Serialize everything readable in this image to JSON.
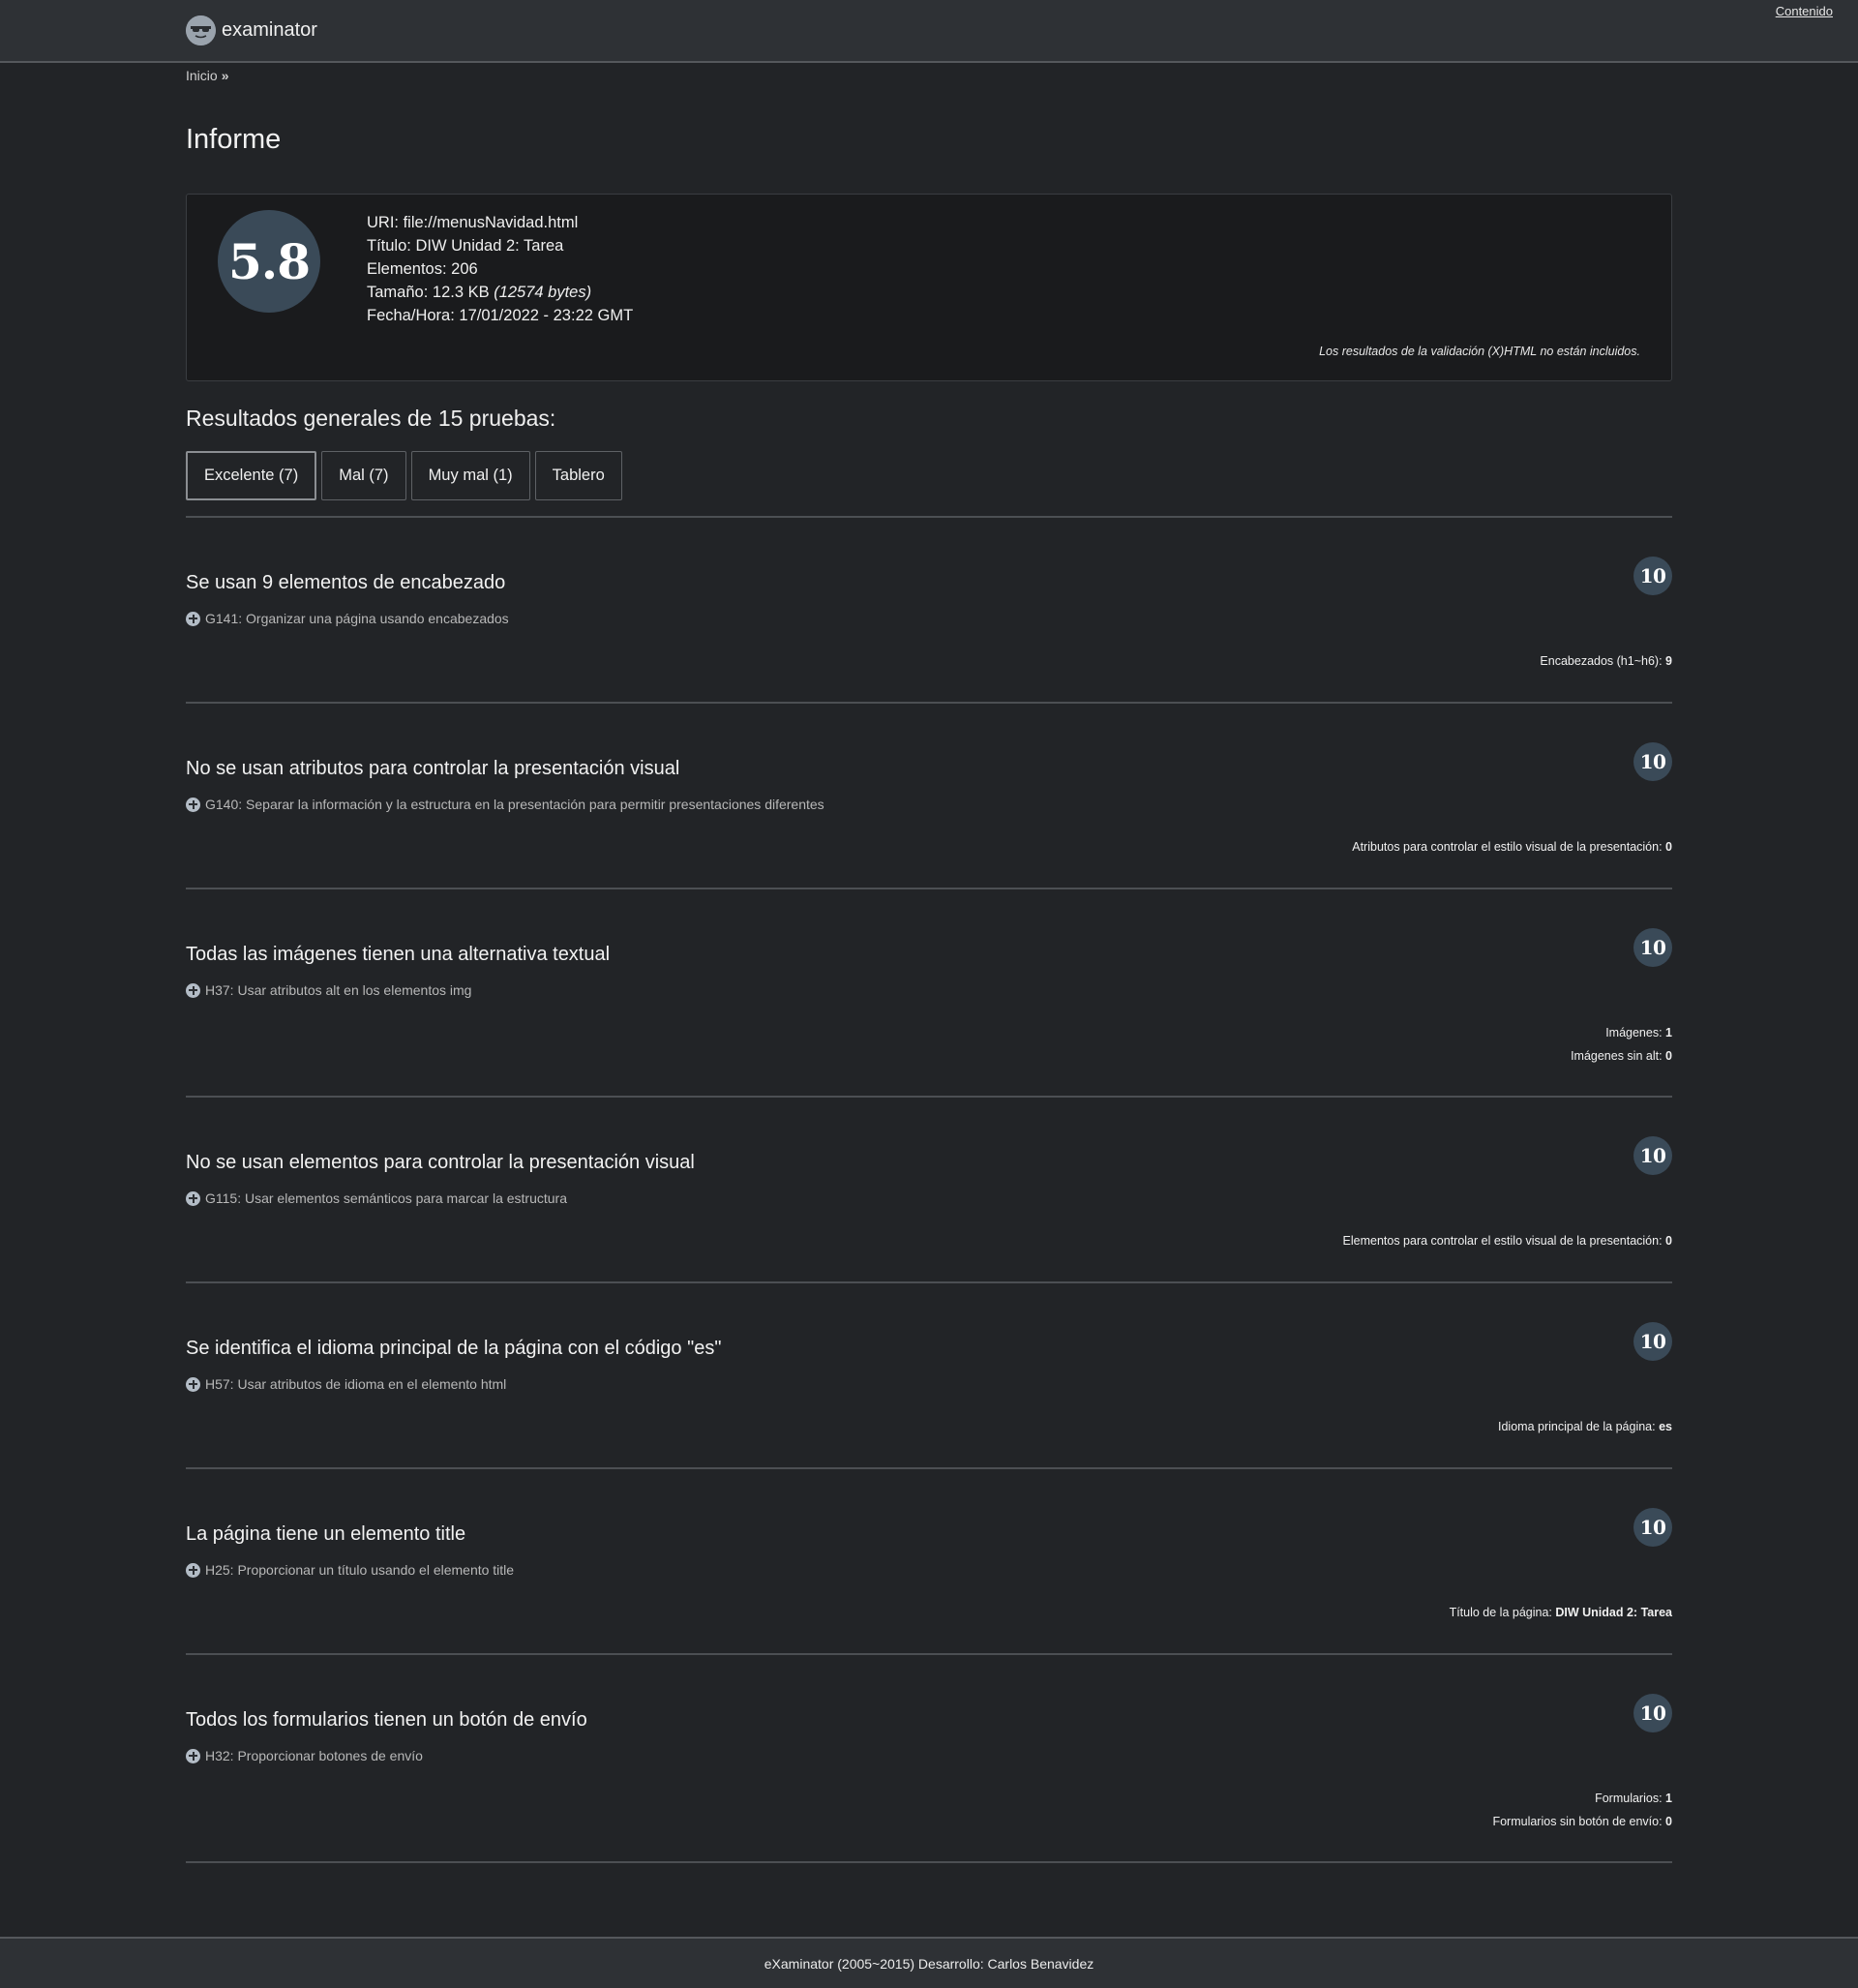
{
  "header": {
    "brand_name": "examinator",
    "skip_link": "Contenido"
  },
  "breadcrumb": {
    "home": "Inicio",
    "separator": "»"
  },
  "page_title": "Informe",
  "summary": {
    "score": "5.8",
    "uri_label": "URI:",
    "uri_value": "file://menusNavidad.html",
    "title_label": "Título:",
    "title_value": "DIW Unidad 2: Tarea",
    "elements_label": "Elementos:",
    "elements_value": "206",
    "size_label": "Tamaño:",
    "size_value": "12.3 KB",
    "size_bytes": "(12574 bytes)",
    "datetime_label": "Fecha/Hora:",
    "datetime_value": "17/01/2022 - 23:22 GMT",
    "validation_note": "Los resultados de la validación (X)HTML no están incluidos."
  },
  "results_heading": "Resultados generales de 15 pruebas:",
  "filter_tabs": [
    {
      "label": "Excelente (7)",
      "active": true
    },
    {
      "label": "Mal (7)",
      "active": false
    },
    {
      "label": "Muy mal (1)",
      "active": false
    },
    {
      "label": "Tablero",
      "active": false
    }
  ],
  "tests": [
    {
      "title": "Se usan 9 elementos de encabezado",
      "ref": "G141: Organizar una página usando encabezados",
      "score": "10",
      "metrics": [
        {
          "label": "Encabezados (h1~h6):",
          "value": "9"
        }
      ]
    },
    {
      "title": "No se usan atributos para controlar la presentación visual",
      "ref": "G140: Separar la información y la estructura en la presentación para permitir presentaciones diferentes",
      "score": "10",
      "metrics": [
        {
          "label": "Atributos para controlar el estilo visual de la presentación:",
          "value": "0"
        }
      ]
    },
    {
      "title": "Todas las imágenes tienen una alternativa textual",
      "ref": "H37: Usar atributos alt en los elementos img",
      "score": "10",
      "metrics": [
        {
          "label": "Imágenes:",
          "value": "1"
        },
        {
          "label": "Imágenes sin alt:",
          "value": "0"
        }
      ]
    },
    {
      "title": "No se usan elementos para controlar la presentación visual",
      "ref": "G115: Usar elementos semánticos para marcar la estructura",
      "score": "10",
      "metrics": [
        {
          "label": "Elementos para controlar el estilo visual de la presentación:",
          "value": "0"
        }
      ]
    },
    {
      "title": "Se identifica el idioma principal de la página con el código \"es\"",
      "ref": "H57: Usar atributos de idioma en el elemento html",
      "score": "10",
      "metrics": [
        {
          "label": "Idioma principal de la página:",
          "value": "es"
        }
      ]
    },
    {
      "title": "La página tiene un elemento title",
      "ref": "H25: Proporcionar un título usando el elemento title",
      "score": "10",
      "metrics": [
        {
          "label": "Título de la página:",
          "value": "DIW Unidad 2: Tarea"
        }
      ]
    },
    {
      "title": "Todos los formularios tienen un botón de envío",
      "ref": "H32: Proporcionar botones de envío",
      "score": "10",
      "metrics": [
        {
          "label": "Formularios:",
          "value": "1"
        },
        {
          "label": "Formularios sin botón de envío:",
          "value": "0"
        }
      ]
    }
  ],
  "footer": "eXaminator (2005~2015) Desarrollo: Carlos Benavidez",
  "colors": {
    "background": "#222427",
    "topbar": "#2e3135",
    "score_badge": "#3a4a58"
  }
}
